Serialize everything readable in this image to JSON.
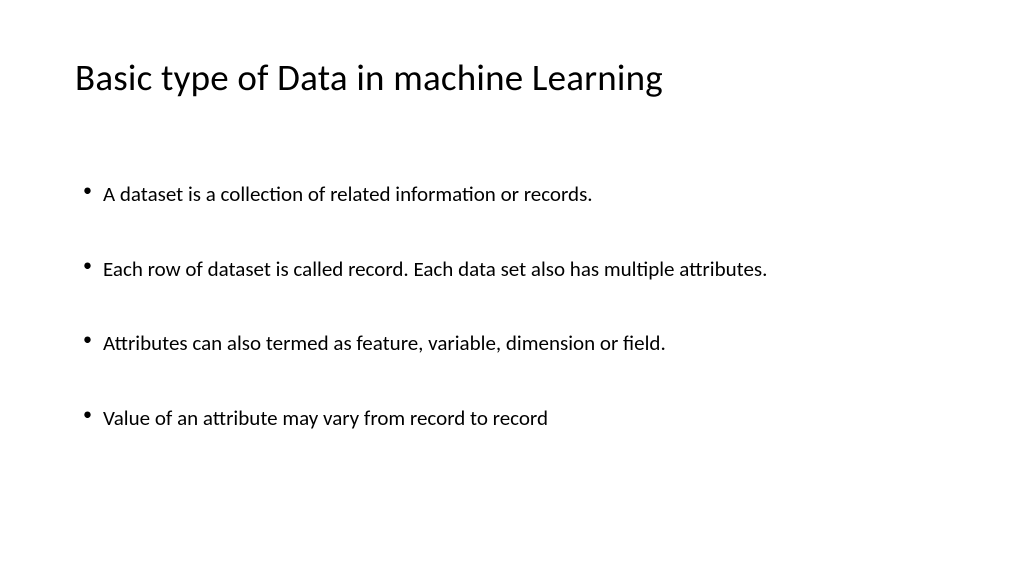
{
  "slide": {
    "title": "Basic type of Data in machine Learning",
    "bullets": [
      "A dataset is a collection of related information or records.",
      "Each row of dataset is called record. Each data set also has multiple attributes.",
      "Attributes can also termed as feature, variable, dimension or field.",
      "Value of an attribute may vary from record to record"
    ]
  }
}
